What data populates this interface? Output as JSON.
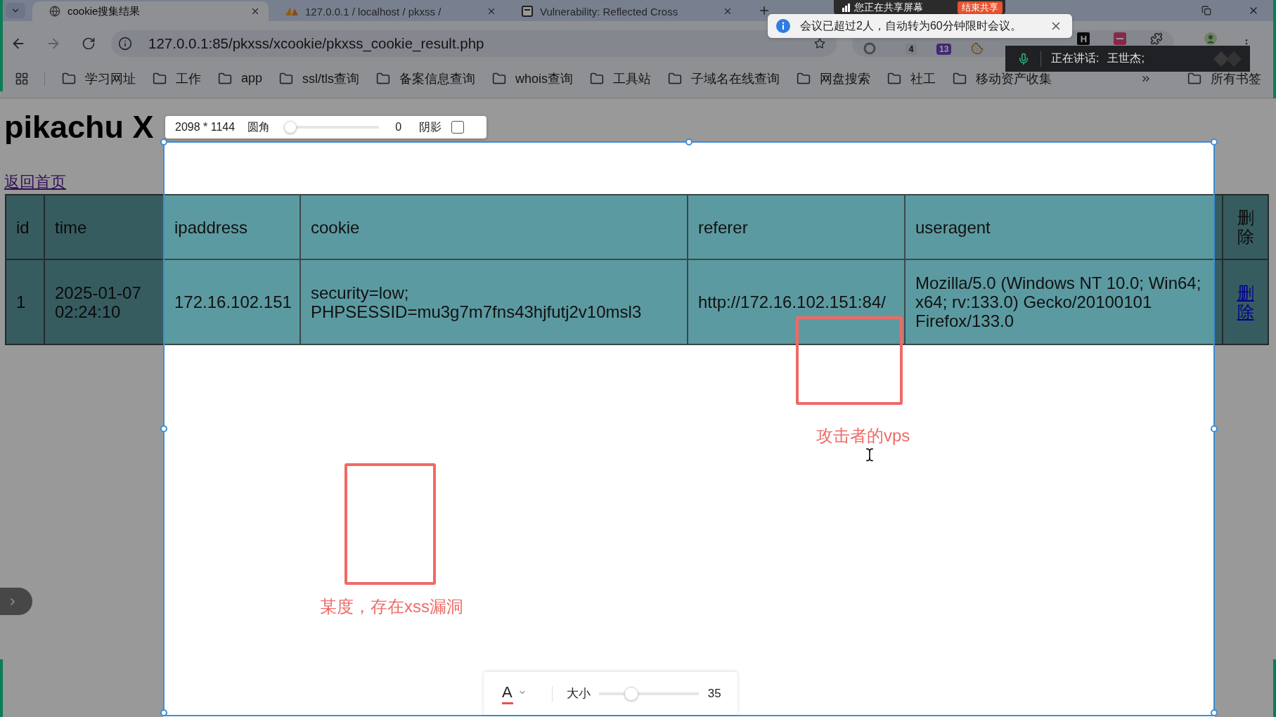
{
  "browser": {
    "tabs": [
      {
        "title": "cookie搜集结果",
        "kind": "globe",
        "selected": true
      },
      {
        "title": "127.0.0.1 / localhost / pkxss /",
        "kind": "sails",
        "selected": false
      },
      {
        "title": "Vulnerability: Reflected Cross",
        "kind": "page",
        "selected": false
      }
    ],
    "address": "127.0.0.1:85/pkxss/xcookie/pkxss_cookie_result.php",
    "extensions": [
      {
        "kind": "ring"
      },
      {
        "kind": "badge",
        "text": "4"
      },
      {
        "kind": "badge_filled",
        "text": "13"
      },
      {
        "kind": "cookie"
      },
      {
        "kind": "letter",
        "text": "H"
      },
      {
        "kind": "tile"
      },
      {
        "kind": "puzzle"
      }
    ],
    "bookmarks": [
      "学习网址",
      "工作",
      "app",
      "ssl/tls查询",
      "备案信息查询",
      "whois查询",
      "工具站",
      "子域名在线查询",
      "网盘搜索",
      "社工",
      "移动资产收集"
    ],
    "all_bookmarks": "所有书签"
  },
  "page": {
    "title": "pikachu X",
    "back_link": "返回首页",
    "table": {
      "columns": [
        "id",
        "time",
        "ipaddress",
        "cookie",
        "referer",
        "useragent",
        "删除"
      ],
      "rows": [
        {
          "cells": [
            "1",
            "2025-01-07 02:24:10",
            "172.16.102.151",
            "security=low; PHPSESSID=mu3g7m7fns43hjfutj2v10msl3",
            "http://172.16.102.151:84/",
            "Mozilla/5.0 (Windows NT 10.0; Win64; x64; rv:133.0) Gecko/20100101 Firefox/133.0"
          ],
          "action": "删除"
        }
      ]
    }
  },
  "capture": {
    "size_bar": {
      "dimensions": "2098 * 1144",
      "radius": {
        "label": "圆角",
        "level": 0,
        "value": "0"
      },
      "shadow": {
        "label": "阴影",
        "checked": false
      }
    },
    "annotations": [
      {
        "kind": "rect"
      },
      {
        "kind": "text",
        "text": "攻击者的vps"
      },
      {
        "kind": "rect"
      },
      {
        "kind": "text",
        "text": "某度，存在xss漏洞"
      }
    ],
    "text_toolbar": {
      "glyph": "A",
      "size": {
        "label": "大小",
        "level": 0.3,
        "value": "35"
      }
    }
  },
  "meeting": {
    "share_banner": {
      "text": "您正在共享屏幕",
      "button": "结束共享"
    },
    "toast": {
      "text": "会议已超过2人，自动转为60分钟限时会议。"
    },
    "speaking": {
      "label": "正在讲话:",
      "speaker": "王世杰;"
    }
  }
}
